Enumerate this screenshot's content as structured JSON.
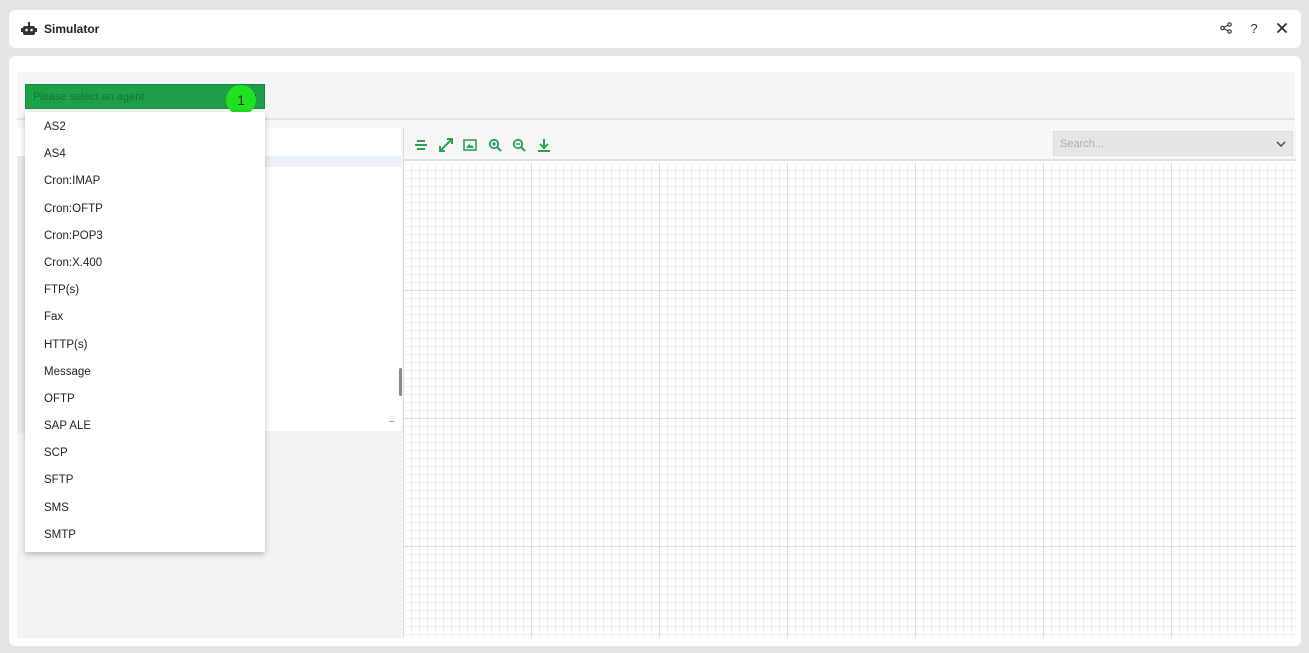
{
  "window": {
    "title": "Simulator",
    "icons": [
      "robot-icon",
      "share-icon",
      "help-icon",
      "close-icon"
    ],
    "help_glyph": "?"
  },
  "agent_selector": {
    "placeholder": "Please select an agent",
    "badge": "1",
    "options": [
      "AS2",
      "AS4",
      "Cron:IMAP",
      "Cron:OFTP",
      "Cron:POP3",
      "Cron:X.400",
      "FTP(s)",
      "Fax",
      "HTTP(s)",
      "Message",
      "OFTP",
      "SAP ALE",
      "SCP",
      "SFTP",
      "SMS",
      "SMTP"
    ]
  },
  "canvas": {
    "toolbar": [
      "align-icon",
      "fit-to-screen-icon",
      "image-icon",
      "zoom-in-icon",
      "zoom-out-icon",
      "download-icon"
    ],
    "search_placeholder": "Search..."
  },
  "colors": {
    "accent": "#1f9f4a",
    "badge": "#22e022"
  }
}
